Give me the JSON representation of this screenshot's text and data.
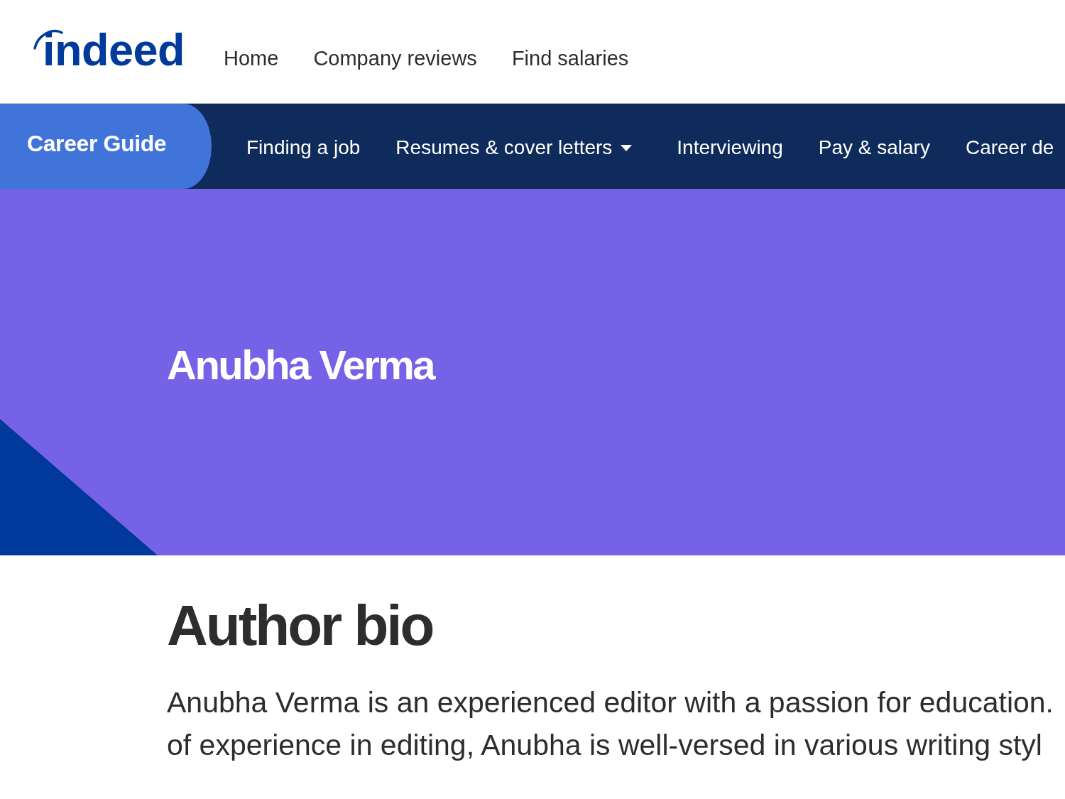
{
  "header": {
    "logo": "indeed",
    "links": [
      "Home",
      "Company reviews",
      "Find salaries"
    ]
  },
  "career_nav": {
    "title": "Career Guide",
    "items": [
      {
        "label": "Finding a job",
        "has_menu": false
      },
      {
        "label": "Resumes & cover letters",
        "has_menu": true
      },
      {
        "label": "Interviewing",
        "has_menu": false
      },
      {
        "label": "Pay & salary",
        "has_menu": false
      },
      {
        "label": "Career de",
        "has_menu": false
      }
    ]
  },
  "hero": {
    "title": "Anubha Verma"
  },
  "bio": {
    "heading": "Author bio",
    "text_lines": [
      "Anubha Verma is an experienced editor with a passion for education.",
      "of experience in editing, Anubha is well-versed in various writing styl"
    ]
  }
}
